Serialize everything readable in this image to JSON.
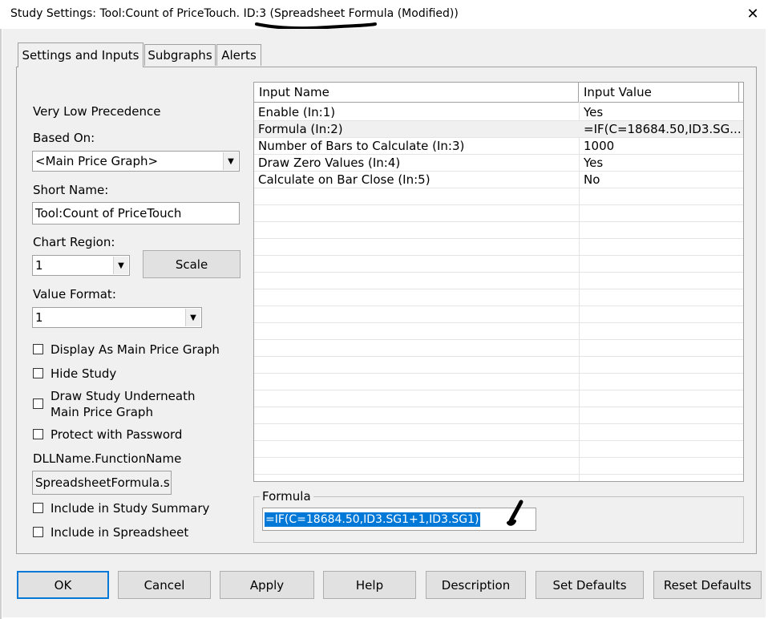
{
  "window": {
    "title": "Study Settings: Tool:Count of PriceTouch. ID:3 (Spreadsheet Formula (Modified))",
    "close_icon": "close-icon"
  },
  "tabs": [
    {
      "label": "Settings and Inputs",
      "active": true
    },
    {
      "label": "Subgraphs",
      "active": false
    },
    {
      "label": "Alerts",
      "active": false
    }
  ],
  "left": {
    "precedence": "Very Low Precedence",
    "based_on_label": "Based On:",
    "based_on_value": "<Main Price Graph>",
    "short_name_label": "Short Name:",
    "short_name_value": "Tool:Count of PriceTouch",
    "chart_region_label": "Chart Region:",
    "chart_region_value": "1",
    "scale_button": "Scale",
    "value_format_label": "Value Format:",
    "value_format_value": "1",
    "checkboxes": {
      "display_main": "Display As Main Price Graph",
      "hide_study": "Hide Study",
      "draw_underneath_1": "Draw Study Underneath",
      "draw_underneath_2": "Main Price Graph",
      "protect": "Protect with Password",
      "include_summary": "Include in Study Summary",
      "include_spreadsheet": "Include in Spreadsheet"
    },
    "dll_label": "DLLName.FunctionName",
    "dll_value": "SpreadsheetFormula.s"
  },
  "grid": {
    "headers": [
      "Input Name",
      "Input Value"
    ],
    "rows": [
      {
        "name": "Enable   (In:1)",
        "value": "Yes"
      },
      {
        "name": "Formula   (In:2)",
        "value": "=IF(C=18684.50,ID3.SG..."
      },
      {
        "name": "Number of Bars to Calculate   (In:3)",
        "value": "1000"
      },
      {
        "name": "Draw Zero Values   (In:4)",
        "value": "Yes"
      },
      {
        "name": "Calculate on Bar Close   (In:5)",
        "value": "No"
      }
    ]
  },
  "formula_box": {
    "label": "Formula",
    "value": "=IF(C=18684.50,ID3.SG1+1,ID3.SG1)"
  },
  "buttons": {
    "ok": "OK",
    "cancel": "Cancel",
    "apply": "Apply",
    "help": "Help",
    "description": "Description",
    "set_defaults": "Set Defaults",
    "reset_defaults": "Reset Defaults"
  },
  "colors": {
    "selection": "#0078d7",
    "dialog_bg": "#f0f0f0"
  }
}
